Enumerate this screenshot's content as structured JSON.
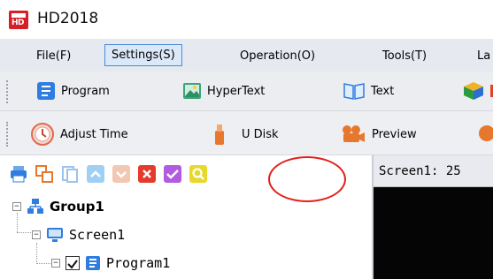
{
  "app": {
    "logo_text": "HD",
    "title": "HD2018"
  },
  "menu": [
    {
      "label": "File(F)",
      "active": false
    },
    {
      "label": "Settings(S)",
      "active": true
    },
    {
      "label": "Operation(O)",
      "active": false
    },
    {
      "label": "Tools(T)",
      "active": false
    },
    {
      "label": "La",
      "active": false
    }
  ],
  "toolbar1": {
    "program": "Program",
    "hypertext": "HyperText",
    "text": "Text"
  },
  "toolbar2": {
    "adjust_time": "Adjust Time",
    "udisk": "U Disk",
    "preview": "Preview"
  },
  "tree": {
    "group": "Group1",
    "screen": "Screen1",
    "program": "Program1"
  },
  "preview_panel": {
    "header": "Screen1: 25"
  },
  "colors": {
    "accent": "#4a8ad8",
    "annotation": "#e2211c",
    "logo": "#d61f26"
  }
}
